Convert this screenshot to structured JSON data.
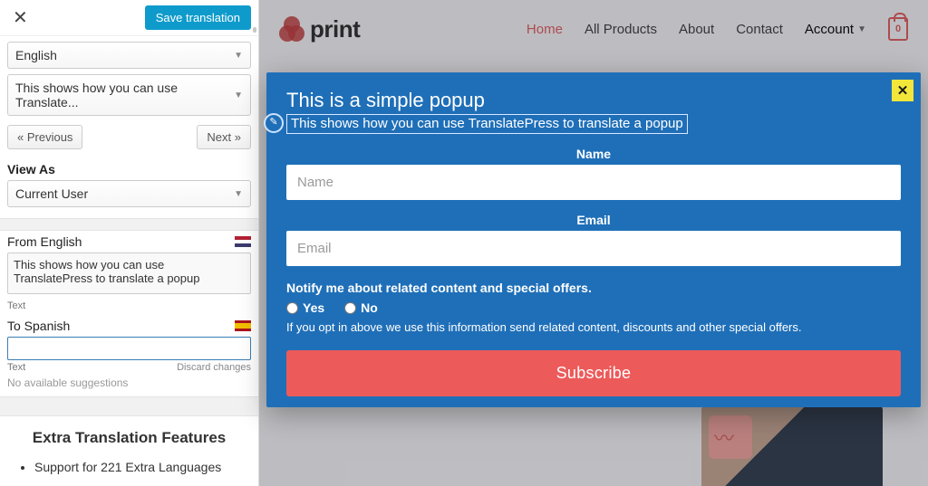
{
  "sidebar": {
    "save_label": "Save translation",
    "language_sel": "English",
    "string_sel": "This shows how you can use Translate...",
    "prev_label": "« Previous",
    "next_label": "Next »",
    "view_as_label": "View As",
    "view_as_value": "Current User",
    "from_label": "From English",
    "from_value": "This shows how you can use TranslatePress to translate a popup",
    "from_type": "Text",
    "to_label": "To Spanish",
    "to_value": "",
    "to_type": "Text",
    "discard_label": "Discard changes",
    "suggestions": "No available suggestions",
    "extra_heading": "Extra Translation Features",
    "extra_item1": "Support for 221 Extra Languages"
  },
  "site": {
    "brand": "print",
    "nav": {
      "home": "Home",
      "products": "All Products",
      "about": "About",
      "contact": "Contact",
      "account": "Account"
    },
    "cart_count": "0"
  },
  "popup": {
    "title": "This is a simple popup",
    "subtitle": "This shows how you can use TranslatePress to translate a popup",
    "name_label": "Name",
    "name_placeholder": "Name",
    "email_label": "Email",
    "email_placeholder": "Email",
    "notify_heading": "Notify me about related content and special offers.",
    "yes": "Yes",
    "no": "No",
    "fineprint": "If you opt in above we use this information send related content, discounts and other special offers.",
    "cta": "Subscribe"
  }
}
